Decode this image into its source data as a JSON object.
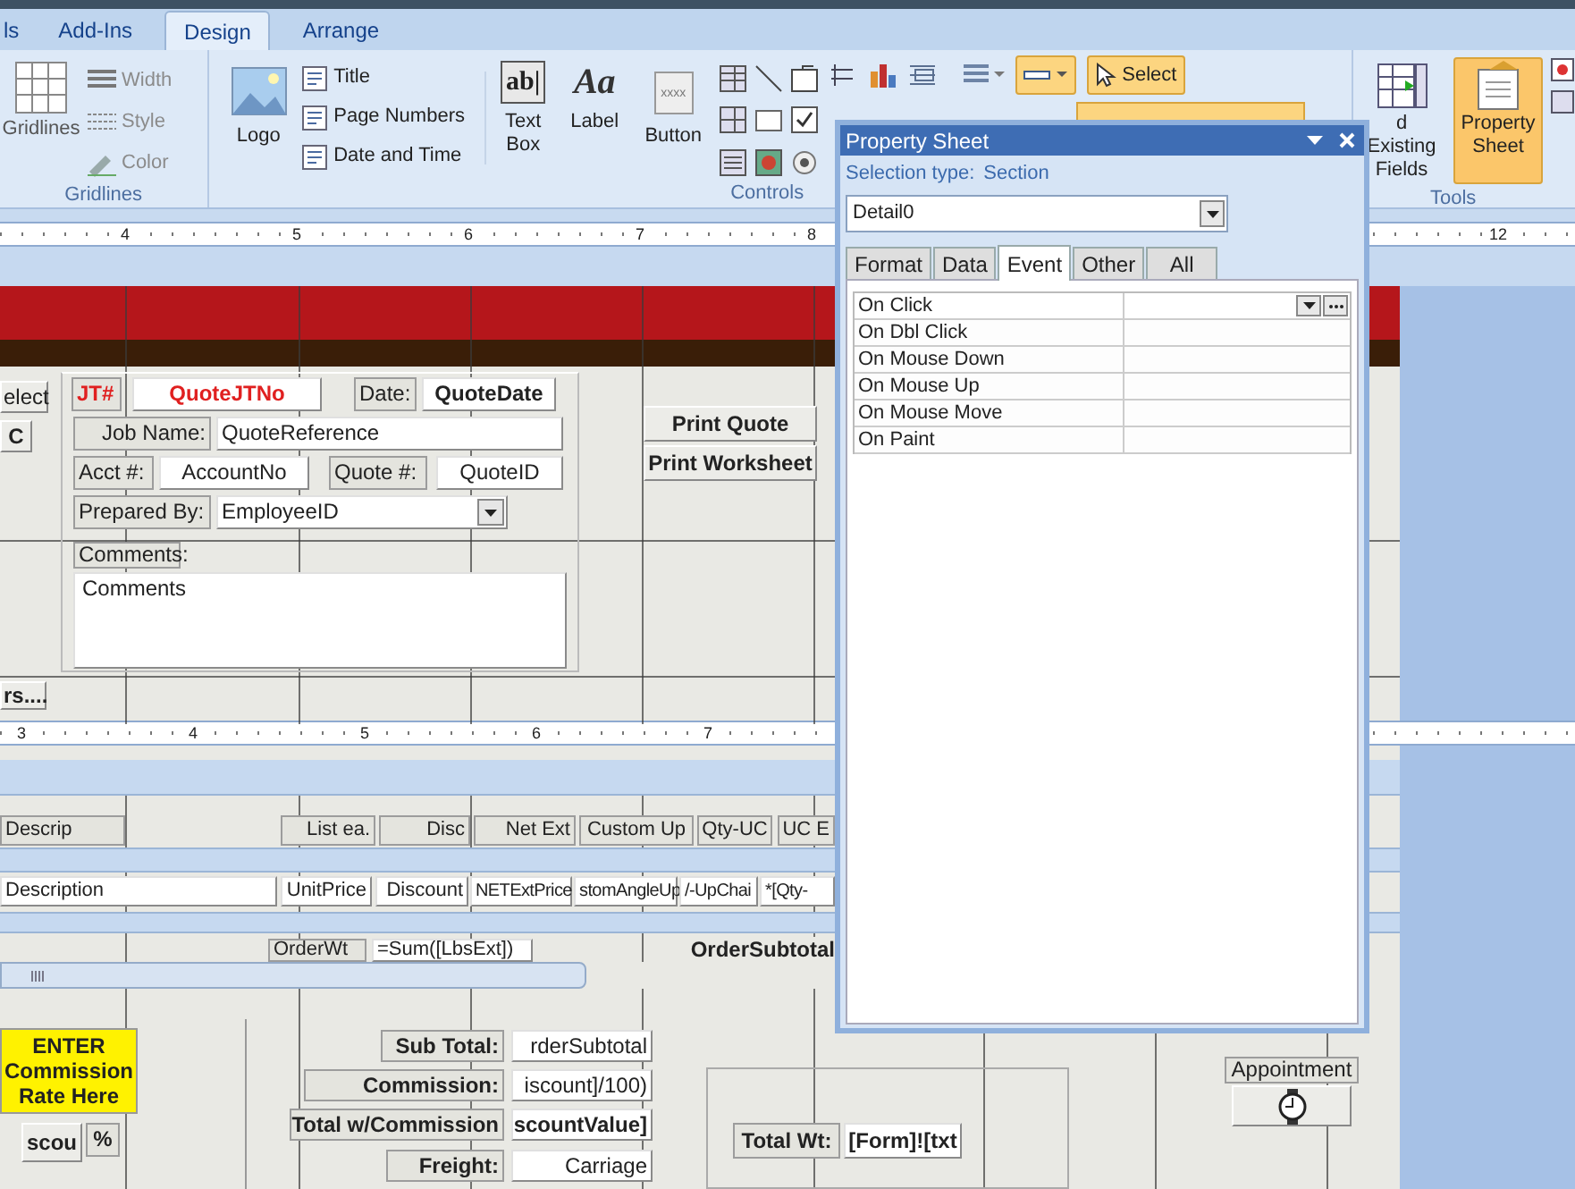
{
  "ribbon_tabs": [
    {
      "label": "ls",
      "selected": false
    },
    {
      "label": "Add-Ins",
      "selected": false
    },
    {
      "label": "Design",
      "selected": true
    },
    {
      "label": "Arrange",
      "selected": false
    }
  ],
  "gridlines_group": {
    "label": "Gridlines",
    "big_button": "Gridlines",
    "small_buttons": [
      "Width",
      "Style",
      "Color"
    ]
  },
  "controls_group": {
    "label": "Controls",
    "logo_button": "Logo",
    "small_buttons": [
      "Title",
      "Page Numbers",
      "Date and Time"
    ],
    "big_buttons": [
      {
        "label": "Text Box",
        "icon_text": "ab|"
      },
      {
        "label": "Label",
        "icon_text": "Aa"
      },
      {
        "label": "Button",
        "icon_text": "xxxx"
      }
    ],
    "select_button": {
      "label": "Select",
      "selected": true
    }
  },
  "tools_group": {
    "label": "Tools",
    "buttons": [
      {
        "label": "d Existing Fields",
        "selected": false
      },
      {
        "label": "Property Sheet",
        "selected": true
      }
    ]
  },
  "top_ruler": [
    "4",
    "5",
    "6",
    "7",
    "8",
    "12"
  ],
  "second_ruler": [
    "3",
    "4",
    "5",
    "6",
    "7"
  ],
  "design_controls": [
    {
      "kind": "button",
      "text": "elect",
      "bold": false
    },
    {
      "kind": "button",
      "text": "C",
      "bold": true
    },
    {
      "kind": "label",
      "text": "JT#",
      "bold": true,
      "color": "#e02020"
    },
    {
      "kind": "field",
      "text": "QuoteJTNo",
      "bold": true,
      "color": "#e02020"
    },
    {
      "kind": "label",
      "text": "Date:",
      "bold": false
    },
    {
      "kind": "field",
      "text": "QuoteDate",
      "bold": true
    },
    {
      "kind": "label",
      "text": "Job Name:",
      "bold": false
    },
    {
      "kind": "field",
      "text": "QuoteReference",
      "bold": false
    },
    {
      "kind": "label",
      "text": "Acct #:",
      "bold": false
    },
    {
      "kind": "field",
      "text": "AccountNo",
      "bold": false
    },
    {
      "kind": "label",
      "text": "Quote #:",
      "bold": false
    },
    {
      "kind": "field",
      "text": "QuoteID",
      "bold": false
    },
    {
      "kind": "label",
      "text": "Prepared By:",
      "bold": false
    },
    {
      "kind": "combo",
      "text": "EmployeeID",
      "bold": false
    },
    {
      "kind": "label",
      "text": "Comments:",
      "bold": false
    },
    {
      "kind": "memo",
      "text": "Comments",
      "bold": false
    },
    {
      "kind": "button",
      "text": "Print Quote",
      "bold": true
    },
    {
      "kind": "button",
      "text": "Print Worksheet",
      "bold": true
    },
    {
      "kind": "button",
      "text": "rs....",
      "bold": true
    },
    {
      "kind": "label",
      "text": "Descrip",
      "bold": false
    },
    {
      "kind": "label",
      "text": "List ea.",
      "bold": false
    },
    {
      "kind": "label",
      "text": "Disc",
      "bold": false
    },
    {
      "kind": "label",
      "text": "Net Ext",
      "bold": false
    },
    {
      "kind": "label",
      "text": "Custom Up",
      "bold": false
    },
    {
      "kind": "label",
      "text": "Qty-UC",
      "bold": false
    },
    {
      "kind": "label",
      "text": "UC E",
      "bold": false
    },
    {
      "kind": "field",
      "text": "Description",
      "bold": false
    },
    {
      "kind": "field",
      "text": "UnitPrice",
      "bold": false
    },
    {
      "kind": "field",
      "text": "Discount",
      "bold": false
    },
    {
      "kind": "field",
      "text": "NETExtPrice",
      "bold": false
    },
    {
      "kind": "field",
      "text": "stomAngleUp",
      "bold": false
    },
    {
      "kind": "field",
      "text": "/-UpChai",
      "bold": false
    },
    {
      "kind": "field",
      "text": "*[Qty-",
      "bold": false
    },
    {
      "kind": "label",
      "text": "OrderWt",
      "bold": false
    },
    {
      "kind": "field",
      "text": "=Sum([LbsExt])",
      "bold": false
    },
    {
      "kind": "plain",
      "text": "OrderSubtotal",
      "bold": true
    },
    {
      "kind": "note",
      "text": "ENTER Commission Rate Here",
      "bold": true
    },
    {
      "kind": "button",
      "text": "scou",
      "bold": true
    },
    {
      "kind": "label",
      "text": "%",
      "bold": true
    },
    {
      "kind": "label",
      "text": "Sub Total:",
      "bold": true
    },
    {
      "kind": "field",
      "text": "rderSubtotal",
      "bold": false
    },
    {
      "kind": "label",
      "text": "Commission:",
      "bold": true
    },
    {
      "kind": "field",
      "text": "iscount]/100)",
      "bold": false
    },
    {
      "kind": "label",
      "text": "Total w/Commission",
      "bold": true
    },
    {
      "kind": "field",
      "text": "scountValue]",
      "bold": true
    },
    {
      "kind": "label",
      "text": "Freight:",
      "bold": true
    },
    {
      "kind": "field",
      "text": "Carriage",
      "bold": false
    },
    {
      "kind": "label",
      "text": "Total Wt:",
      "bold": true
    },
    {
      "kind": "field",
      "text": "[Form]![txt",
      "bold": true
    },
    {
      "kind": "label",
      "text": "Appointment",
      "bold": false
    },
    {
      "kind": "clock_button"
    }
  ],
  "property_sheet": {
    "title": "Property Sheet",
    "selection_label": "Selection type:",
    "selection_type": "Section",
    "object": "Detail0",
    "tabs": [
      {
        "label": "Format",
        "selected": false
      },
      {
        "label": "Data",
        "selected": false
      },
      {
        "label": "Event",
        "selected": true
      },
      {
        "label": "Other",
        "selected": false
      },
      {
        "label": "All",
        "selected": false
      }
    ],
    "properties": [
      {
        "name": "On Click",
        "selected": true
      },
      {
        "name": "On Dbl Click",
        "selected": false
      },
      {
        "name": "On Mouse Down",
        "selected": false
      },
      {
        "name": "On Mouse Up",
        "selected": false
      },
      {
        "name": "On Mouse Move",
        "selected": false
      },
      {
        "name": "On Paint",
        "selected": false
      }
    ]
  }
}
